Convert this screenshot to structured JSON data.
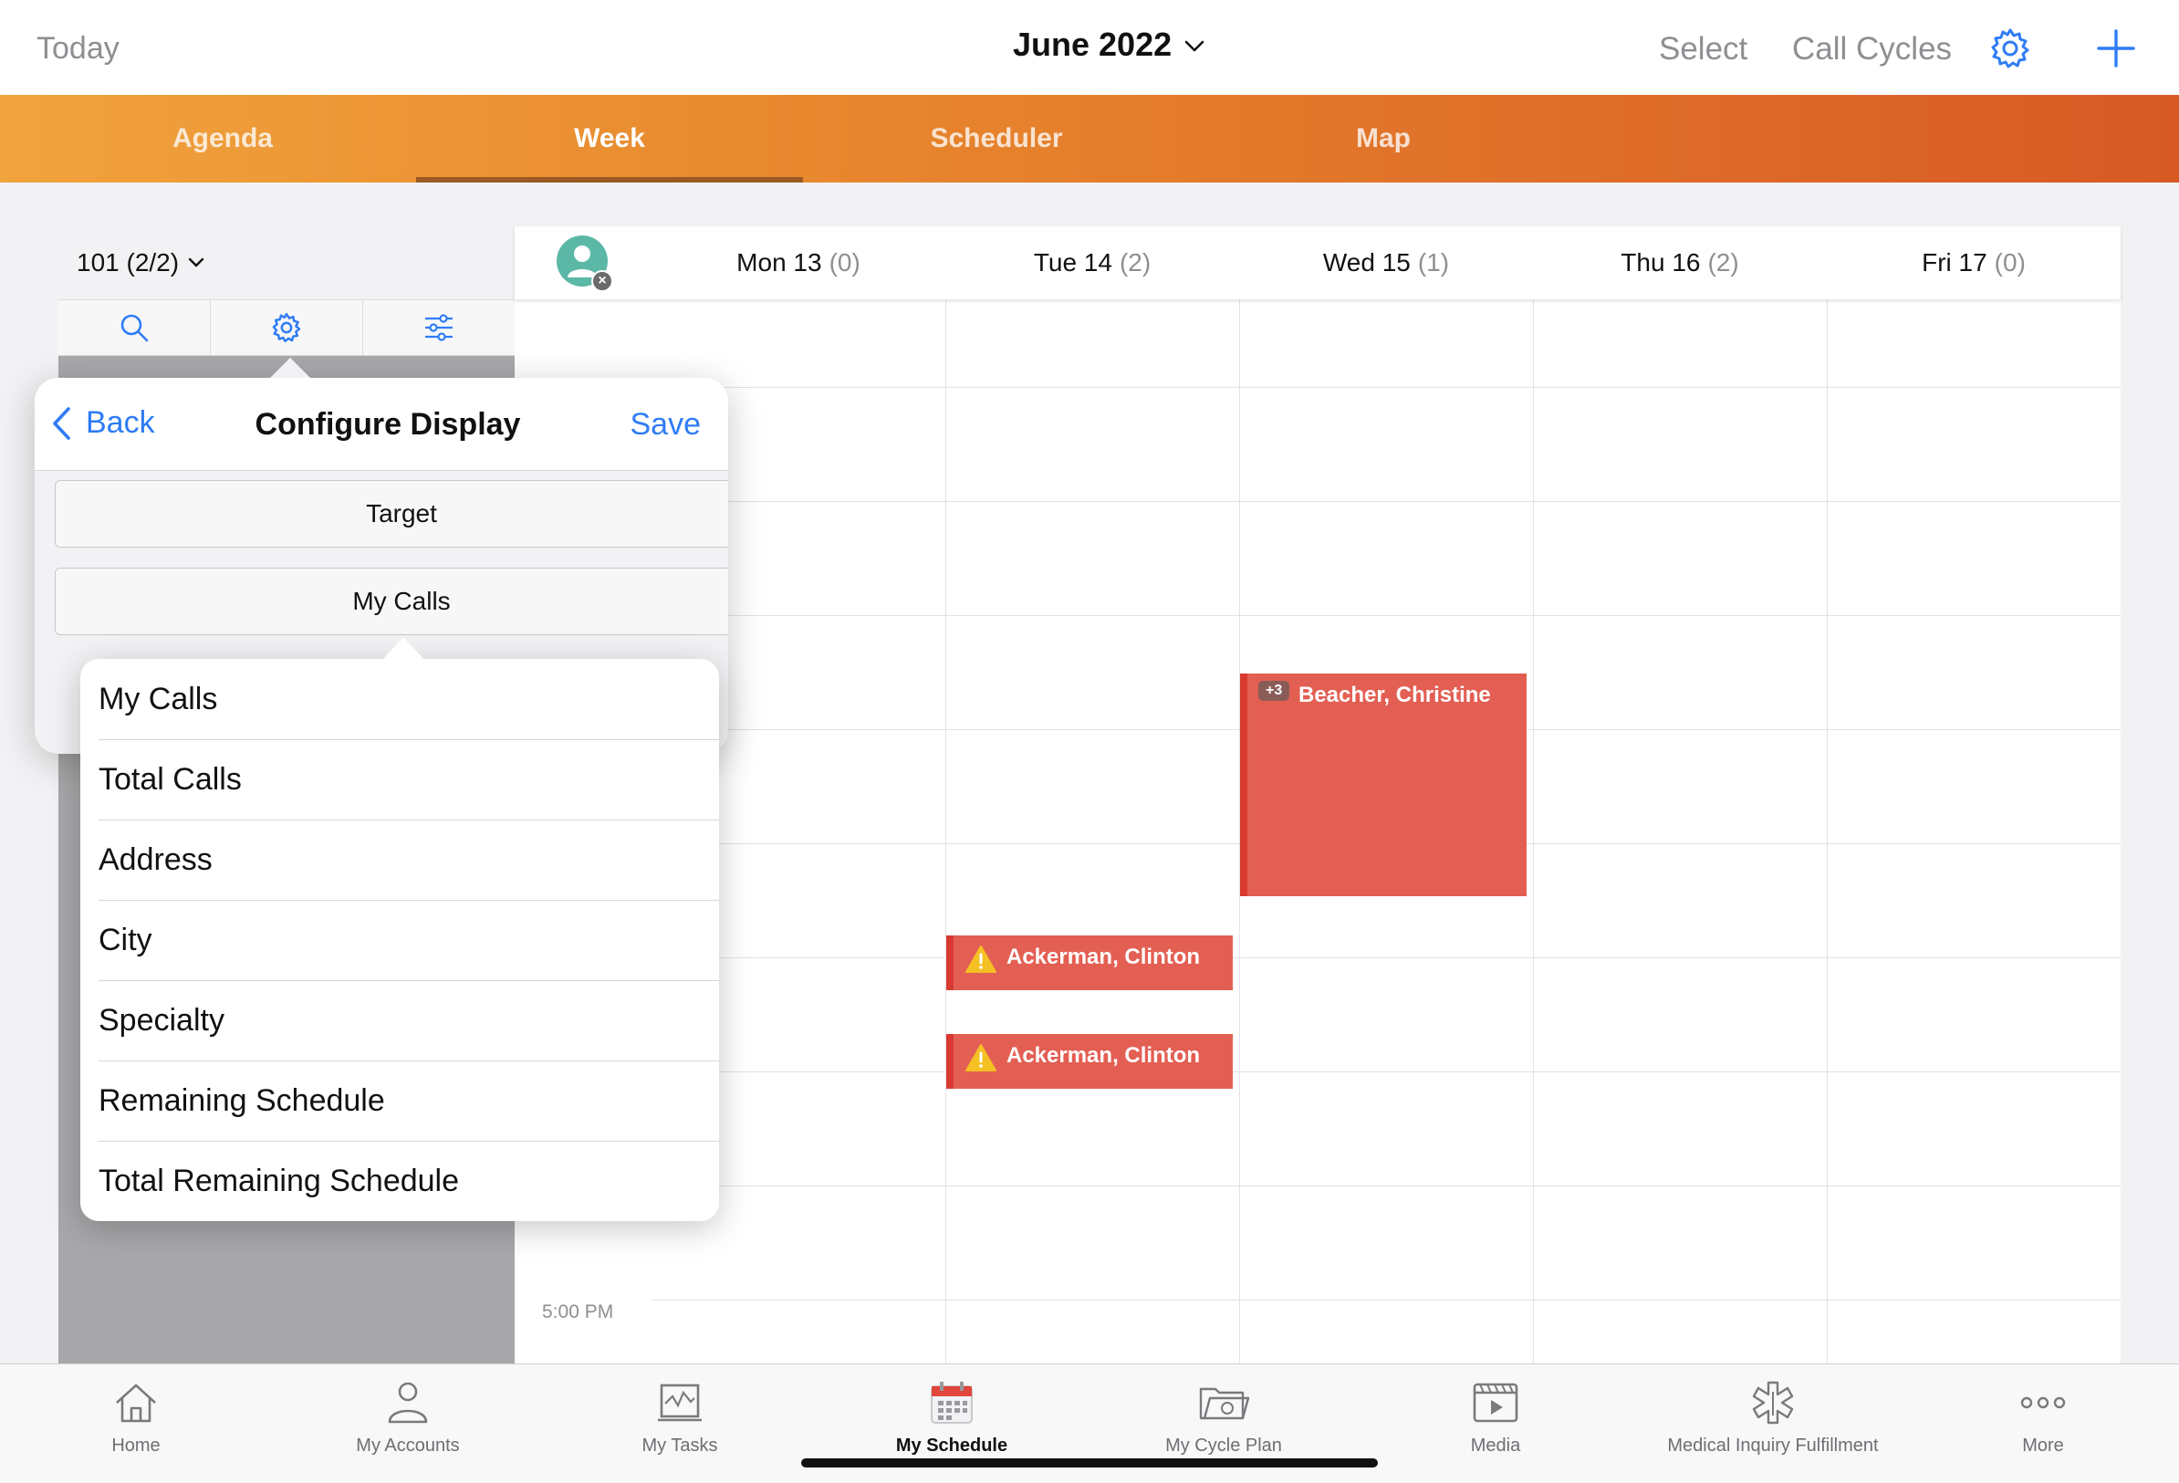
{
  "topbar": {
    "today_label": "Today",
    "month_label": "June 2022",
    "select_label": "Select",
    "call_cycles_label": "Call Cycles"
  },
  "view_tabs": [
    {
      "label": "Agenda",
      "active": false
    },
    {
      "label": "Week",
      "active": true
    },
    {
      "label": "Scheduler",
      "active": false
    },
    {
      "label": "Map",
      "active": false
    }
  ],
  "left_panel": {
    "territory_label": "101 (2/2)"
  },
  "calendar": {
    "days": [
      {
        "label": "Mon 13",
        "count": "(0)"
      },
      {
        "label": "Tue 14",
        "count": "(2)"
      },
      {
        "label": "Wed 15",
        "count": "(1)"
      },
      {
        "label": "Thu 16",
        "count": "(2)"
      },
      {
        "label": "Fri 17",
        "count": "(0)"
      }
    ],
    "time_labels": [
      "5:00 PM"
    ],
    "events": [
      {
        "day": "Wed 15",
        "title": "Beacher, Christine",
        "badge": "+3"
      },
      {
        "day": "Tue 14",
        "title": "Ackerman, Clinton",
        "warning": true
      },
      {
        "day": "Tue 14",
        "title": "Ackerman, Clinton",
        "warning": true
      }
    ],
    "event_color": "#e35f53"
  },
  "configure_display": {
    "back_label": "Back",
    "title": "Configure Display",
    "save_label": "Save",
    "options": [
      {
        "label": "Target"
      },
      {
        "label": "My Calls"
      }
    ]
  },
  "dropdown": {
    "items": [
      "My Calls",
      "Total Calls",
      "Address",
      "City",
      "Specialty",
      "Remaining Schedule",
      "Total Remaining Schedule"
    ]
  },
  "bottom_nav": [
    {
      "label": "Home",
      "icon": "home-icon",
      "active": false
    },
    {
      "label": "My Accounts",
      "icon": "accounts-icon",
      "active": false
    },
    {
      "label": "My Tasks",
      "icon": "tasks-icon",
      "active": false
    },
    {
      "label": "My Schedule",
      "icon": "calendar-icon",
      "active": true
    },
    {
      "label": "My Cycle Plan",
      "icon": "cycle-plan-icon",
      "active": false
    },
    {
      "label": "Media",
      "icon": "media-icon",
      "active": false
    },
    {
      "label": "Medical Inquiry Fulfillment",
      "icon": "medical-icon",
      "active": false
    },
    {
      "label": "More",
      "icon": "more-icon",
      "active": false
    }
  ],
  "colors": {
    "accent_blue": "#2f7cf6",
    "tab_bar_start": "#f1a33d",
    "tab_bar_end": "#d75a25",
    "event_red": "#e35f53"
  }
}
